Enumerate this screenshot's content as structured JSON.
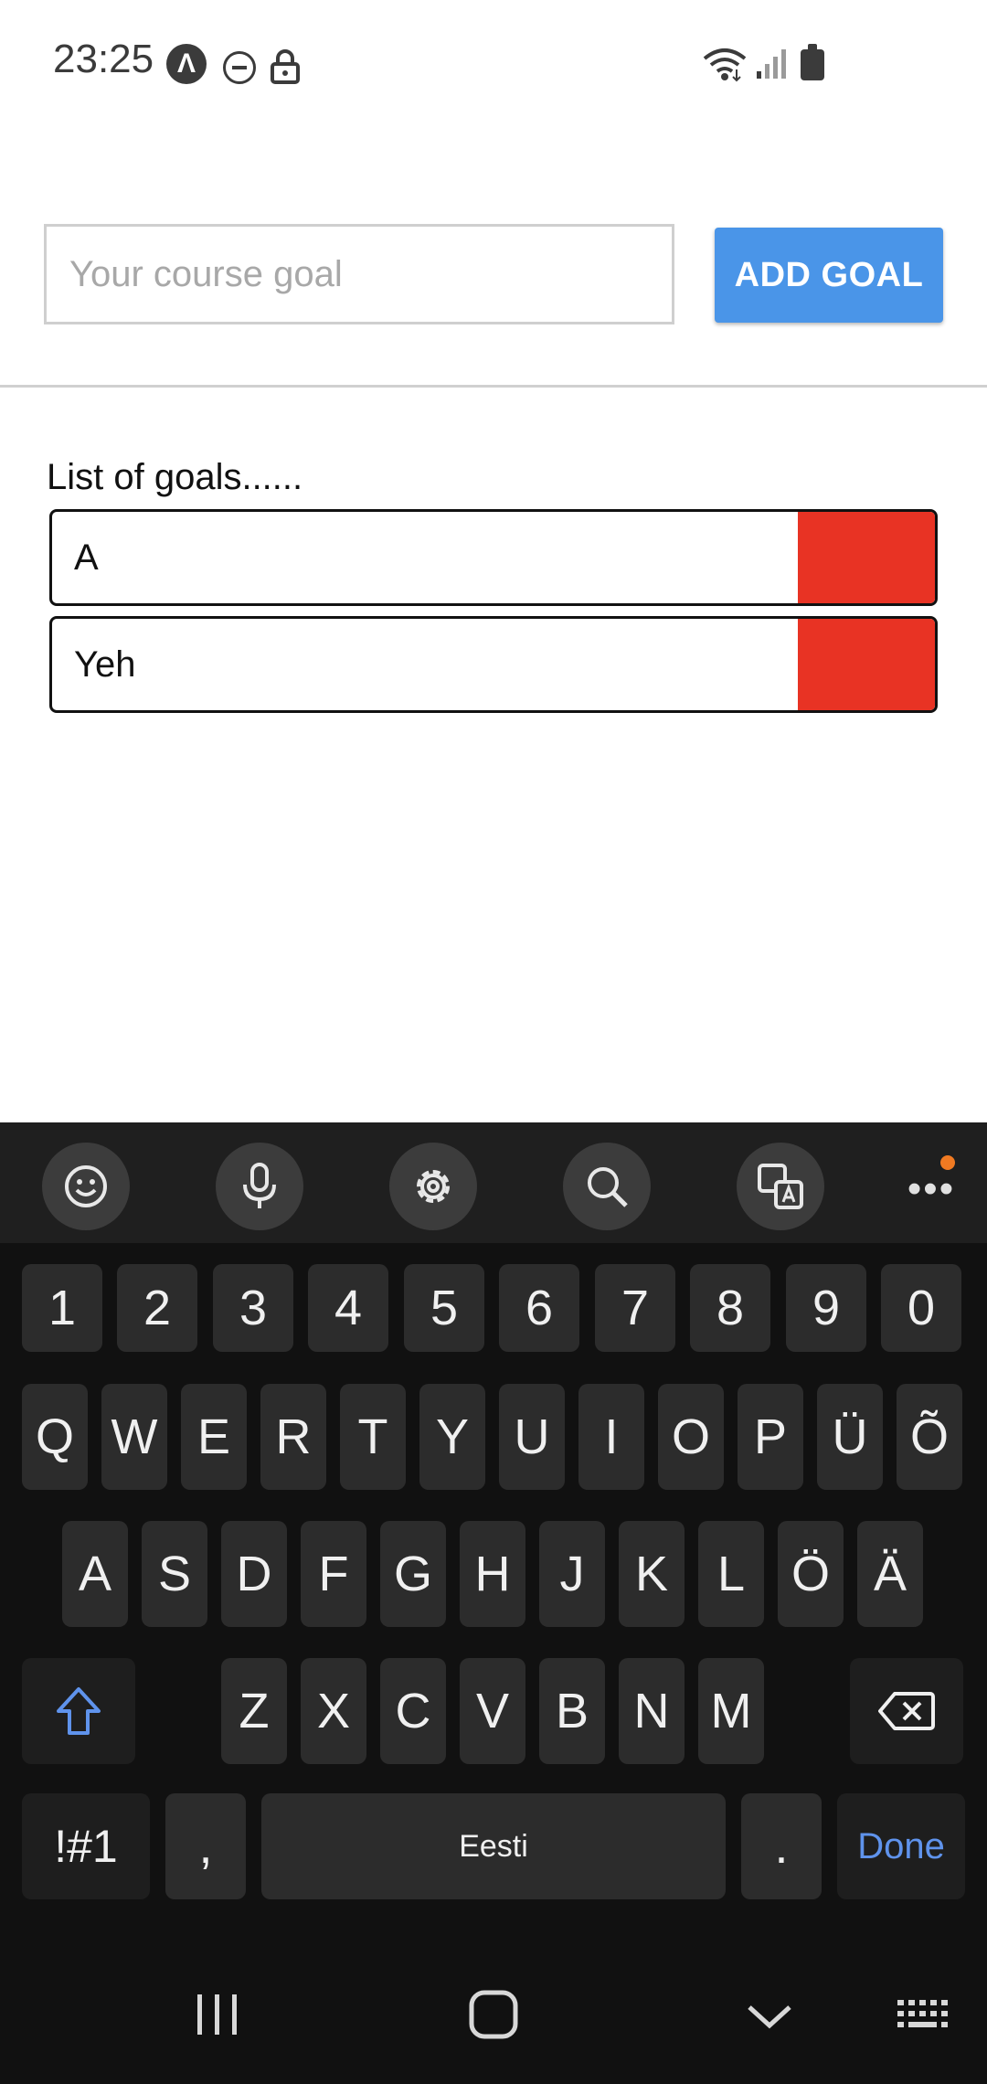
{
  "status_bar": {
    "time": "23:25",
    "icons": [
      "app-notification-icon",
      "do-not-disturb-icon",
      "lock-icon",
      "wifi-icon",
      "signal-icon",
      "battery-icon"
    ],
    "app_icon_glyph": "Λ"
  },
  "goal_form": {
    "input_placeholder": "Your course goal",
    "input_value": "",
    "add_button_label": "ADD GOAL"
  },
  "goals_list": {
    "title": "List of goals......",
    "items": [
      {
        "text": "A"
      },
      {
        "text": "Yeh"
      }
    ]
  },
  "keyboard": {
    "toolbar": [
      "emoji-icon",
      "microphone-icon",
      "settings-icon",
      "search-icon",
      "translate-icon",
      "more-icon"
    ],
    "number_row": [
      "1",
      "2",
      "3",
      "4",
      "5",
      "6",
      "7",
      "8",
      "9",
      "0"
    ],
    "row1": [
      "Q",
      "W",
      "E",
      "R",
      "T",
      "Y",
      "U",
      "I",
      "O",
      "P",
      "Ü",
      "Õ"
    ],
    "row2": [
      "A",
      "S",
      "D",
      "F",
      "G",
      "H",
      "J",
      "K",
      "L",
      "Ö",
      "Ä"
    ],
    "row3": [
      "Z",
      "X",
      "C",
      "V",
      "B",
      "N",
      "M"
    ],
    "symbols_key": "!#1",
    "comma_key": ",",
    "space_label": "Eesti",
    "period_key": ".",
    "done_label": "Done"
  },
  "colors": {
    "accent_button": "#4a95e8",
    "delete_red": "#e83324",
    "keyboard_bg": "#111111",
    "key_bg": "#2c2c2c",
    "done_blue": "#5f93ec",
    "notification_dot": "#f07a22"
  }
}
